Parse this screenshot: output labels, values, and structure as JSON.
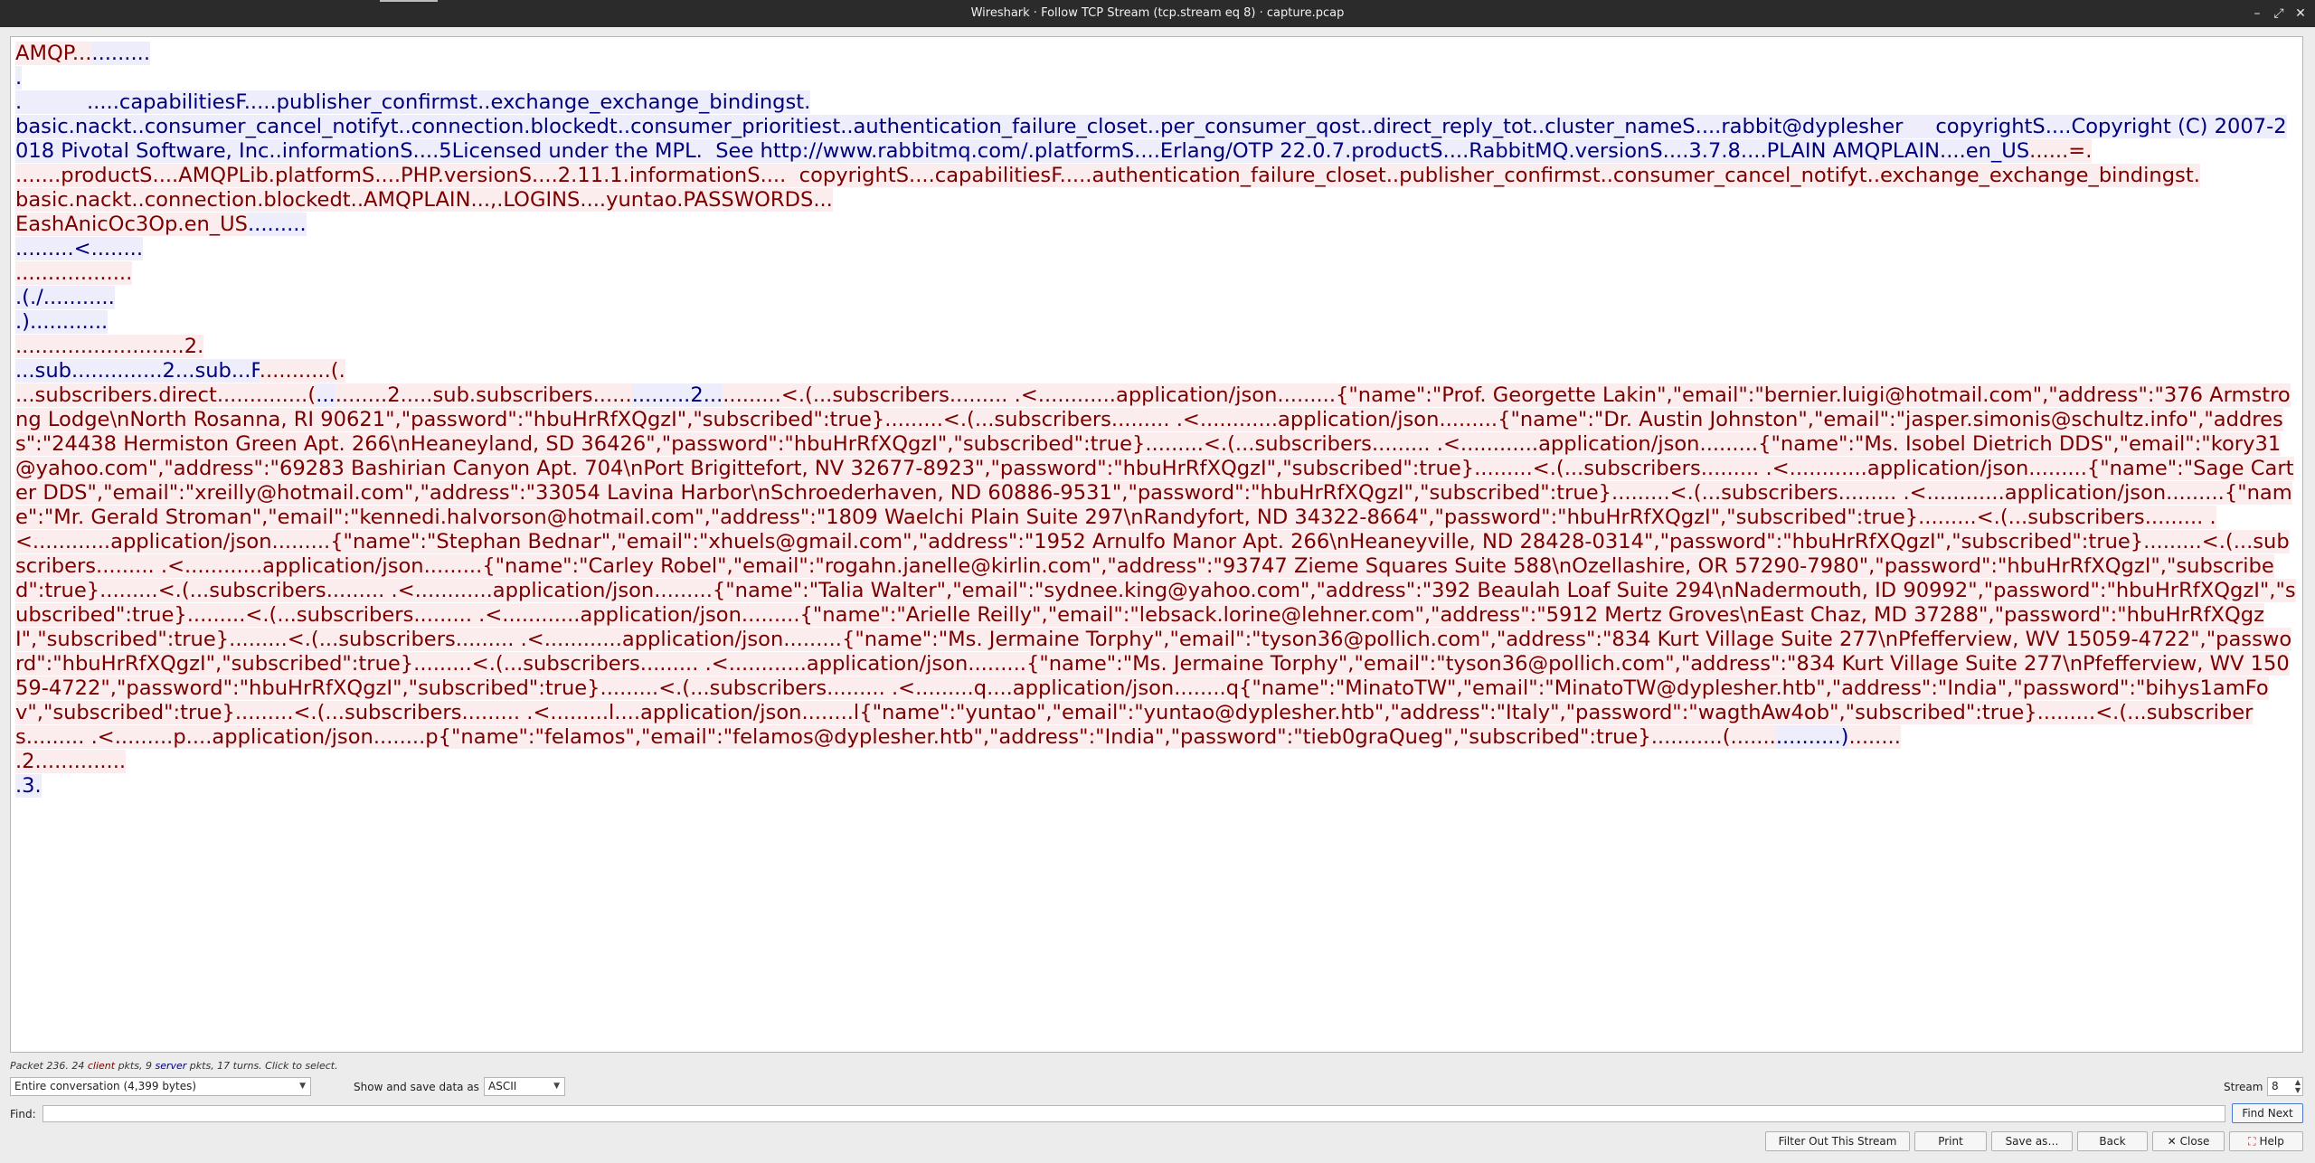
{
  "window": {
    "title": "Wireshark · Follow TCP Stream (tcp.stream eq 8) · capture.pcap",
    "controls": [
      "–",
      "⤢",
      "✕"
    ]
  },
  "stream": {
    "chunks": [
      {
        "dir": "client",
        "text": "AMQP..."
      },
      {
        "dir": "server",
        "text": ".........\n.\n.          .....capabilitiesF.....publisher_confirmst..exchange_exchange_bindingst.\nbasic.nackt..consumer_cancel_notifyt..connection.blockedt..consumer_prioritiest..authentication_failure_closet..per_consumer_qost..direct_reply_tot..cluster_nameS....rabbit@dyplesher     copyrightS....Copyright (C) 2007-2018 Pivotal Software, Inc..informationS....5Licensed under the MPL.  See http://www.rabbitmq.com/.platformS....Erlang/OTP 22.0.7.productS....RabbitMQ.versionS....3.7.8....PLAIN AMQPLAIN....en_US"
      },
      {
        "dir": "client",
        "text": "......=.\n.......productS....AMQPLib.platformS....PHP.versionS....2.11.1.informationS....  copyrightS....capabilitiesF.....authentication_failure_closet..publisher_confirmst..consumer_cancel_notifyt..exchange_exchange_bindingst.\nbasic.nackt..connection.blockedt..AMQPLAIN...,.LOGINS....yuntao.PASSWORDS...\nEashAnicOc3Op.en_US"
      },
      {
        "dir": "server",
        "text": ".........\n.........<........\n"
      },
      {
        "dir": "client",
        "text": "..................\n"
      },
      {
        "dir": "server",
        "text": ".(./...........\n.)............\n"
      },
      {
        "dir": "client",
        "text": "...................."
      },
      {
        "dir": "client",
        "text": "......2.\n"
      },
      {
        "dir": "server",
        "text": "...sub..............2...sub...F"
      },
      {
        "dir": "client",
        "text": "...........(.\n"
      },
      {
        "dir": "client",
        "text": "...subscribers.direct..............("
      },
      {
        "dir": "server",
        "text": "..."
      },
      {
        "dir": "client",
        "text": "........2.....sub.subscribers......"
      },
      {
        "dir": "server",
        "text": ".........2..."
      },
      {
        "dir": "client",
        "text": ".........<.(...subscribers......... .<............application/json.........{\"name\":\"Prof. Georgette Lakin\",\"email\":\"bernier.luigi@hotmail.com\",\"address\":\"376 Armstrong Lodge\\nNorth Rosanna, RI 90621\",\"password\":\"hbuHrRfXQgzI\",\"subscribed\":true}.........<.(...subscribers......... .<............application/json.........{\"name\":\"Dr. Austin Johnston\",\"email\":\"jasper.simonis@schultz.info\",\"address\":\"24438 Hermiston Green Apt. 266\\nHeaneyland, SD 36426\",\"password\":\"hbuHrRfXQgzI\",\"subscribed\":true}.........<.(...subscribers......... .<............application/json.........{\"name\":\"Ms. Isobel Dietrich DDS\",\"email\":\"kory31@yahoo.com\",\"address\":\"69283 Bashirian Canyon Apt. 704\\nPort Brigittefort, NV 32677-8923\",\"password\":\"hbuHrRfXQgzI\",\"subscribed\":true}.........<.(...subscribers......... .<............application/json.........{\"name\":\"Sage Carter DDS\",\"email\":\"xreilly@hotmail.com\",\"address\":\"33054 Lavina Harbor\\nSchroederhaven, ND 60886-9531\",\"password\":\"hbuHrRfXQgzI\",\"subscribed\":true}.........<.(...subscribers......... .<............application/json.........{\"name\":\"Mr. Gerald Stroman\",\"email\":\"kennedi.halvorson@hotmail.com\",\"address\":\"1809 Waelchi Plain Suite 297\\nRandyfort, ND 34322-8664\",\"password\":\"hbuHrRfXQgzI\",\"subscribed\":true}.........<.(...subscribers......... .<............application/json.........{\"name\":\"Stephan Bednar\",\"email\":\"xhuels@gmail.com\",\"address\":\"1952 Arnulfo Manor Apt. 266\\nHeaneyville, ND 28428-0314\",\"password\":\"hbuHrRfXQgzI\",\"subscribed\":true}.........<.(...subscribers......... .<............application/json.........{\"name\":\"Carley Robel\",\"email\":\"rogahn.janelle@kirlin.com\",\"address\":\"93747 Zieme Squares Suite 588\\nOzellashire, OR 57290-7980\",\"password\":\"hbuHrRfXQgzI\",\"subscribed\":true}.........<.(...subscribers......... .<............application/json.........{\"name\":\"Talia Walter\",\"email\":\"sydnee.king@yahoo.com\",\"address\":\"392 Beaulah Loaf Suite 294\\nNadermouth, ID 90992\",\"password\":\"hbuHrRfXQgzI\",\"subscribed\":true}.........<.(...subscribers......... .<............application/json.........{\"name\":\"Arielle Reilly\",\"email\":\"lebsack.lorine@lehner.com\",\"address\":\"5912 Mertz Groves\\nEast Chaz, MD 37288\",\"password\":\"hbuHrRfXQgzI\",\"subscribed\":true}.........<.(...subscribers......... .<............application/json.........{\"name\":\"Ms. Jermaine Torphy\",\"email\":\"tyson36@pollich.com\",\"address\":\"834 Kurt Village Suite 277\\nPfefferview, WV 15059-4722\",\"password\":\"hbuHrRfXQgzI\",\"subscribed\":true}.........<.(...subscribers......... .<............application/json.........{\"name\":\"Ms. Jermaine Torphy\",\"email\":\"tyson36@pollich.com\",\"address\":\"834 Kurt Village Suite 277\\nPfefferview, WV 15059-4722\",\"password\":\"hbuHrRfXQgzI\",\"subscribed\":true}.........<.(...subscribers......... .<.........q....application/json........q{\"name\":\"MinatoTW\",\"email\":\"MinatoTW@dyplesher.htb\",\"address\":\"India\",\"password\":\"bihys1amFov\",\"subscribed\":true}.........<.(...subscribers......... .<.........l....application/json........l{\"name\":\"yuntao\",\"email\":\"yuntao@dyplesher.htb\",\"address\":\"Italy\",\"password\":\"wagthAw4ob\",\"subscribed\":true}.........<.(...subscribers......... .<.........p....application/json........p{\"name\":\"felamos\",\"email\":\"felamos@dyplesher.htb\",\"address\":\"India\",\"password\":\"tieb0graQueg\",\"subscribed\":true}...........(......."
      },
      {
        "dir": "server",
        "text": "..........)"
      },
      {
        "dir": "client",
        "text": "........\n.2..............\n"
      },
      {
        "dir": "server",
        "text": ".3."
      }
    ]
  },
  "status": {
    "prefix": "Packet 236. 24 ",
    "client_word": "client",
    "mid": " pkts, 9 ",
    "server_word": "server",
    "suffix": " pkts, 17 turns. Click to select."
  },
  "controls": {
    "conversation_select": "Entire conversation (4,399 bytes)",
    "show_save_label": "Show and save data as",
    "format_select": "ASCII",
    "stream_label": "Stream",
    "stream_value": "8",
    "find_label": "Find:",
    "find_value": "",
    "find_next": "Find Next"
  },
  "buttons": {
    "filter_out": "Filter Out This Stream",
    "print": "Print",
    "save_as": "Save as…",
    "back": "Back",
    "close": "Close",
    "help": "Help"
  },
  "colors": {
    "client_fg": "#7a0000",
    "client_bg": "#fbeded",
    "server_fg": "#00007a",
    "server_bg": "#ededfb"
  }
}
